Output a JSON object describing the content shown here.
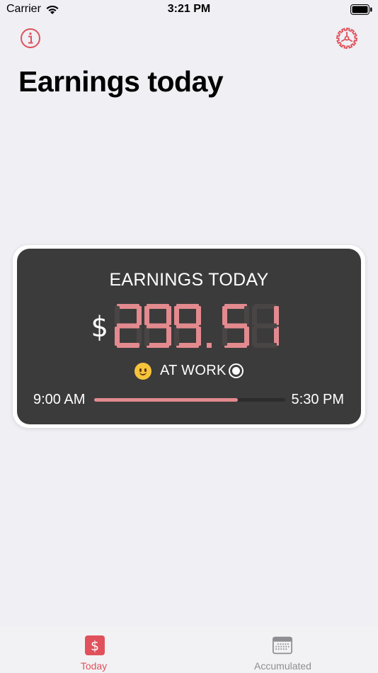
{
  "status_bar": {
    "carrier": "Carrier",
    "time": "3:21 PM"
  },
  "header": {
    "info_icon": "info-circle-icon",
    "settings_icon": "gear-icon",
    "title": "Earnings today"
  },
  "card": {
    "title": "EARNINGS TODAY",
    "currency": "$",
    "amount": "299.51",
    "status_label": "AT WORK",
    "status_emoji": "slightly-smiling-face",
    "start_time": "9:00 AM",
    "end_time": "5:30 PM",
    "progress": 0.75
  },
  "colors": {
    "accent": "#e0515b",
    "digit_lit": "#e38a8f",
    "digit_unlit": "#4a4545",
    "card_bg": "#3b3b3b"
  },
  "tab_bar": {
    "tabs": [
      {
        "label": "Today",
        "icon": "dollar-icon",
        "active": true
      },
      {
        "label": "Accumulated",
        "icon": "calendar-icon",
        "active": false
      }
    ]
  }
}
